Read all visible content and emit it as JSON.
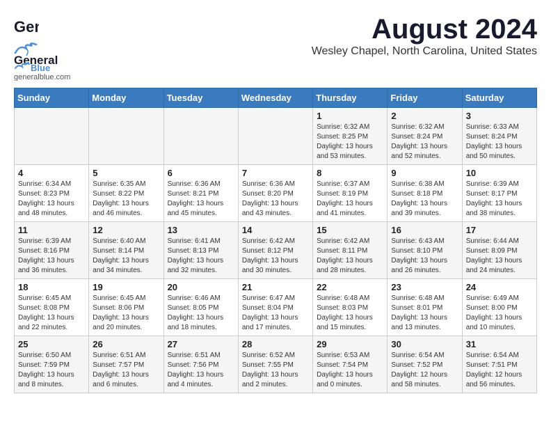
{
  "header": {
    "logo_general": "General",
    "logo_blue": "Blue",
    "main_title": "August 2024",
    "subtitle": "Wesley Chapel, North Carolina, United States"
  },
  "calendar": {
    "days_of_week": [
      "Sunday",
      "Monday",
      "Tuesday",
      "Wednesday",
      "Thursday",
      "Friday",
      "Saturday"
    ],
    "weeks": [
      [
        {
          "day": "",
          "content": ""
        },
        {
          "day": "",
          "content": ""
        },
        {
          "day": "",
          "content": ""
        },
        {
          "day": "",
          "content": ""
        },
        {
          "day": "1",
          "content": "Sunrise: 6:32 AM\nSunset: 8:25 PM\nDaylight: 13 hours\nand 53 minutes."
        },
        {
          "day": "2",
          "content": "Sunrise: 6:32 AM\nSunset: 8:24 PM\nDaylight: 13 hours\nand 52 minutes."
        },
        {
          "day": "3",
          "content": "Sunrise: 6:33 AM\nSunset: 8:24 PM\nDaylight: 13 hours\nand 50 minutes."
        }
      ],
      [
        {
          "day": "4",
          "content": "Sunrise: 6:34 AM\nSunset: 8:23 PM\nDaylight: 13 hours\nand 48 minutes."
        },
        {
          "day": "5",
          "content": "Sunrise: 6:35 AM\nSunset: 8:22 PM\nDaylight: 13 hours\nand 46 minutes."
        },
        {
          "day": "6",
          "content": "Sunrise: 6:36 AM\nSunset: 8:21 PM\nDaylight: 13 hours\nand 45 minutes."
        },
        {
          "day": "7",
          "content": "Sunrise: 6:36 AM\nSunset: 8:20 PM\nDaylight: 13 hours\nand 43 minutes."
        },
        {
          "day": "8",
          "content": "Sunrise: 6:37 AM\nSunset: 8:19 PM\nDaylight: 13 hours\nand 41 minutes."
        },
        {
          "day": "9",
          "content": "Sunrise: 6:38 AM\nSunset: 8:18 PM\nDaylight: 13 hours\nand 39 minutes."
        },
        {
          "day": "10",
          "content": "Sunrise: 6:39 AM\nSunset: 8:17 PM\nDaylight: 13 hours\nand 38 minutes."
        }
      ],
      [
        {
          "day": "11",
          "content": "Sunrise: 6:39 AM\nSunset: 8:16 PM\nDaylight: 13 hours\nand 36 minutes."
        },
        {
          "day": "12",
          "content": "Sunrise: 6:40 AM\nSunset: 8:14 PM\nDaylight: 13 hours\nand 34 minutes."
        },
        {
          "day": "13",
          "content": "Sunrise: 6:41 AM\nSunset: 8:13 PM\nDaylight: 13 hours\nand 32 minutes."
        },
        {
          "day": "14",
          "content": "Sunrise: 6:42 AM\nSunset: 8:12 PM\nDaylight: 13 hours\nand 30 minutes."
        },
        {
          "day": "15",
          "content": "Sunrise: 6:42 AM\nSunset: 8:11 PM\nDaylight: 13 hours\nand 28 minutes."
        },
        {
          "day": "16",
          "content": "Sunrise: 6:43 AM\nSunset: 8:10 PM\nDaylight: 13 hours\nand 26 minutes."
        },
        {
          "day": "17",
          "content": "Sunrise: 6:44 AM\nSunset: 8:09 PM\nDaylight: 13 hours\nand 24 minutes."
        }
      ],
      [
        {
          "day": "18",
          "content": "Sunrise: 6:45 AM\nSunset: 8:08 PM\nDaylight: 13 hours\nand 22 minutes."
        },
        {
          "day": "19",
          "content": "Sunrise: 6:45 AM\nSunset: 8:06 PM\nDaylight: 13 hours\nand 20 minutes."
        },
        {
          "day": "20",
          "content": "Sunrise: 6:46 AM\nSunset: 8:05 PM\nDaylight: 13 hours\nand 18 minutes."
        },
        {
          "day": "21",
          "content": "Sunrise: 6:47 AM\nSunset: 8:04 PM\nDaylight: 13 hours\nand 17 minutes."
        },
        {
          "day": "22",
          "content": "Sunrise: 6:48 AM\nSunset: 8:03 PM\nDaylight: 13 hours\nand 15 minutes."
        },
        {
          "day": "23",
          "content": "Sunrise: 6:48 AM\nSunset: 8:01 PM\nDaylight: 13 hours\nand 13 minutes."
        },
        {
          "day": "24",
          "content": "Sunrise: 6:49 AM\nSunset: 8:00 PM\nDaylight: 13 hours\nand 10 minutes."
        }
      ],
      [
        {
          "day": "25",
          "content": "Sunrise: 6:50 AM\nSunset: 7:59 PM\nDaylight: 13 hours\nand 8 minutes."
        },
        {
          "day": "26",
          "content": "Sunrise: 6:51 AM\nSunset: 7:57 PM\nDaylight: 13 hours\nand 6 minutes."
        },
        {
          "day": "27",
          "content": "Sunrise: 6:51 AM\nSunset: 7:56 PM\nDaylight: 13 hours\nand 4 minutes."
        },
        {
          "day": "28",
          "content": "Sunrise: 6:52 AM\nSunset: 7:55 PM\nDaylight: 13 hours\nand 2 minutes."
        },
        {
          "day": "29",
          "content": "Sunrise: 6:53 AM\nSunset: 7:54 PM\nDaylight: 13 hours\nand 0 minutes."
        },
        {
          "day": "30",
          "content": "Sunrise: 6:54 AM\nSunset: 7:52 PM\nDaylight: 12 hours\nand 58 minutes."
        },
        {
          "day": "31",
          "content": "Sunrise: 6:54 AM\nSunset: 7:51 PM\nDaylight: 12 hours\nand 56 minutes."
        }
      ]
    ]
  }
}
